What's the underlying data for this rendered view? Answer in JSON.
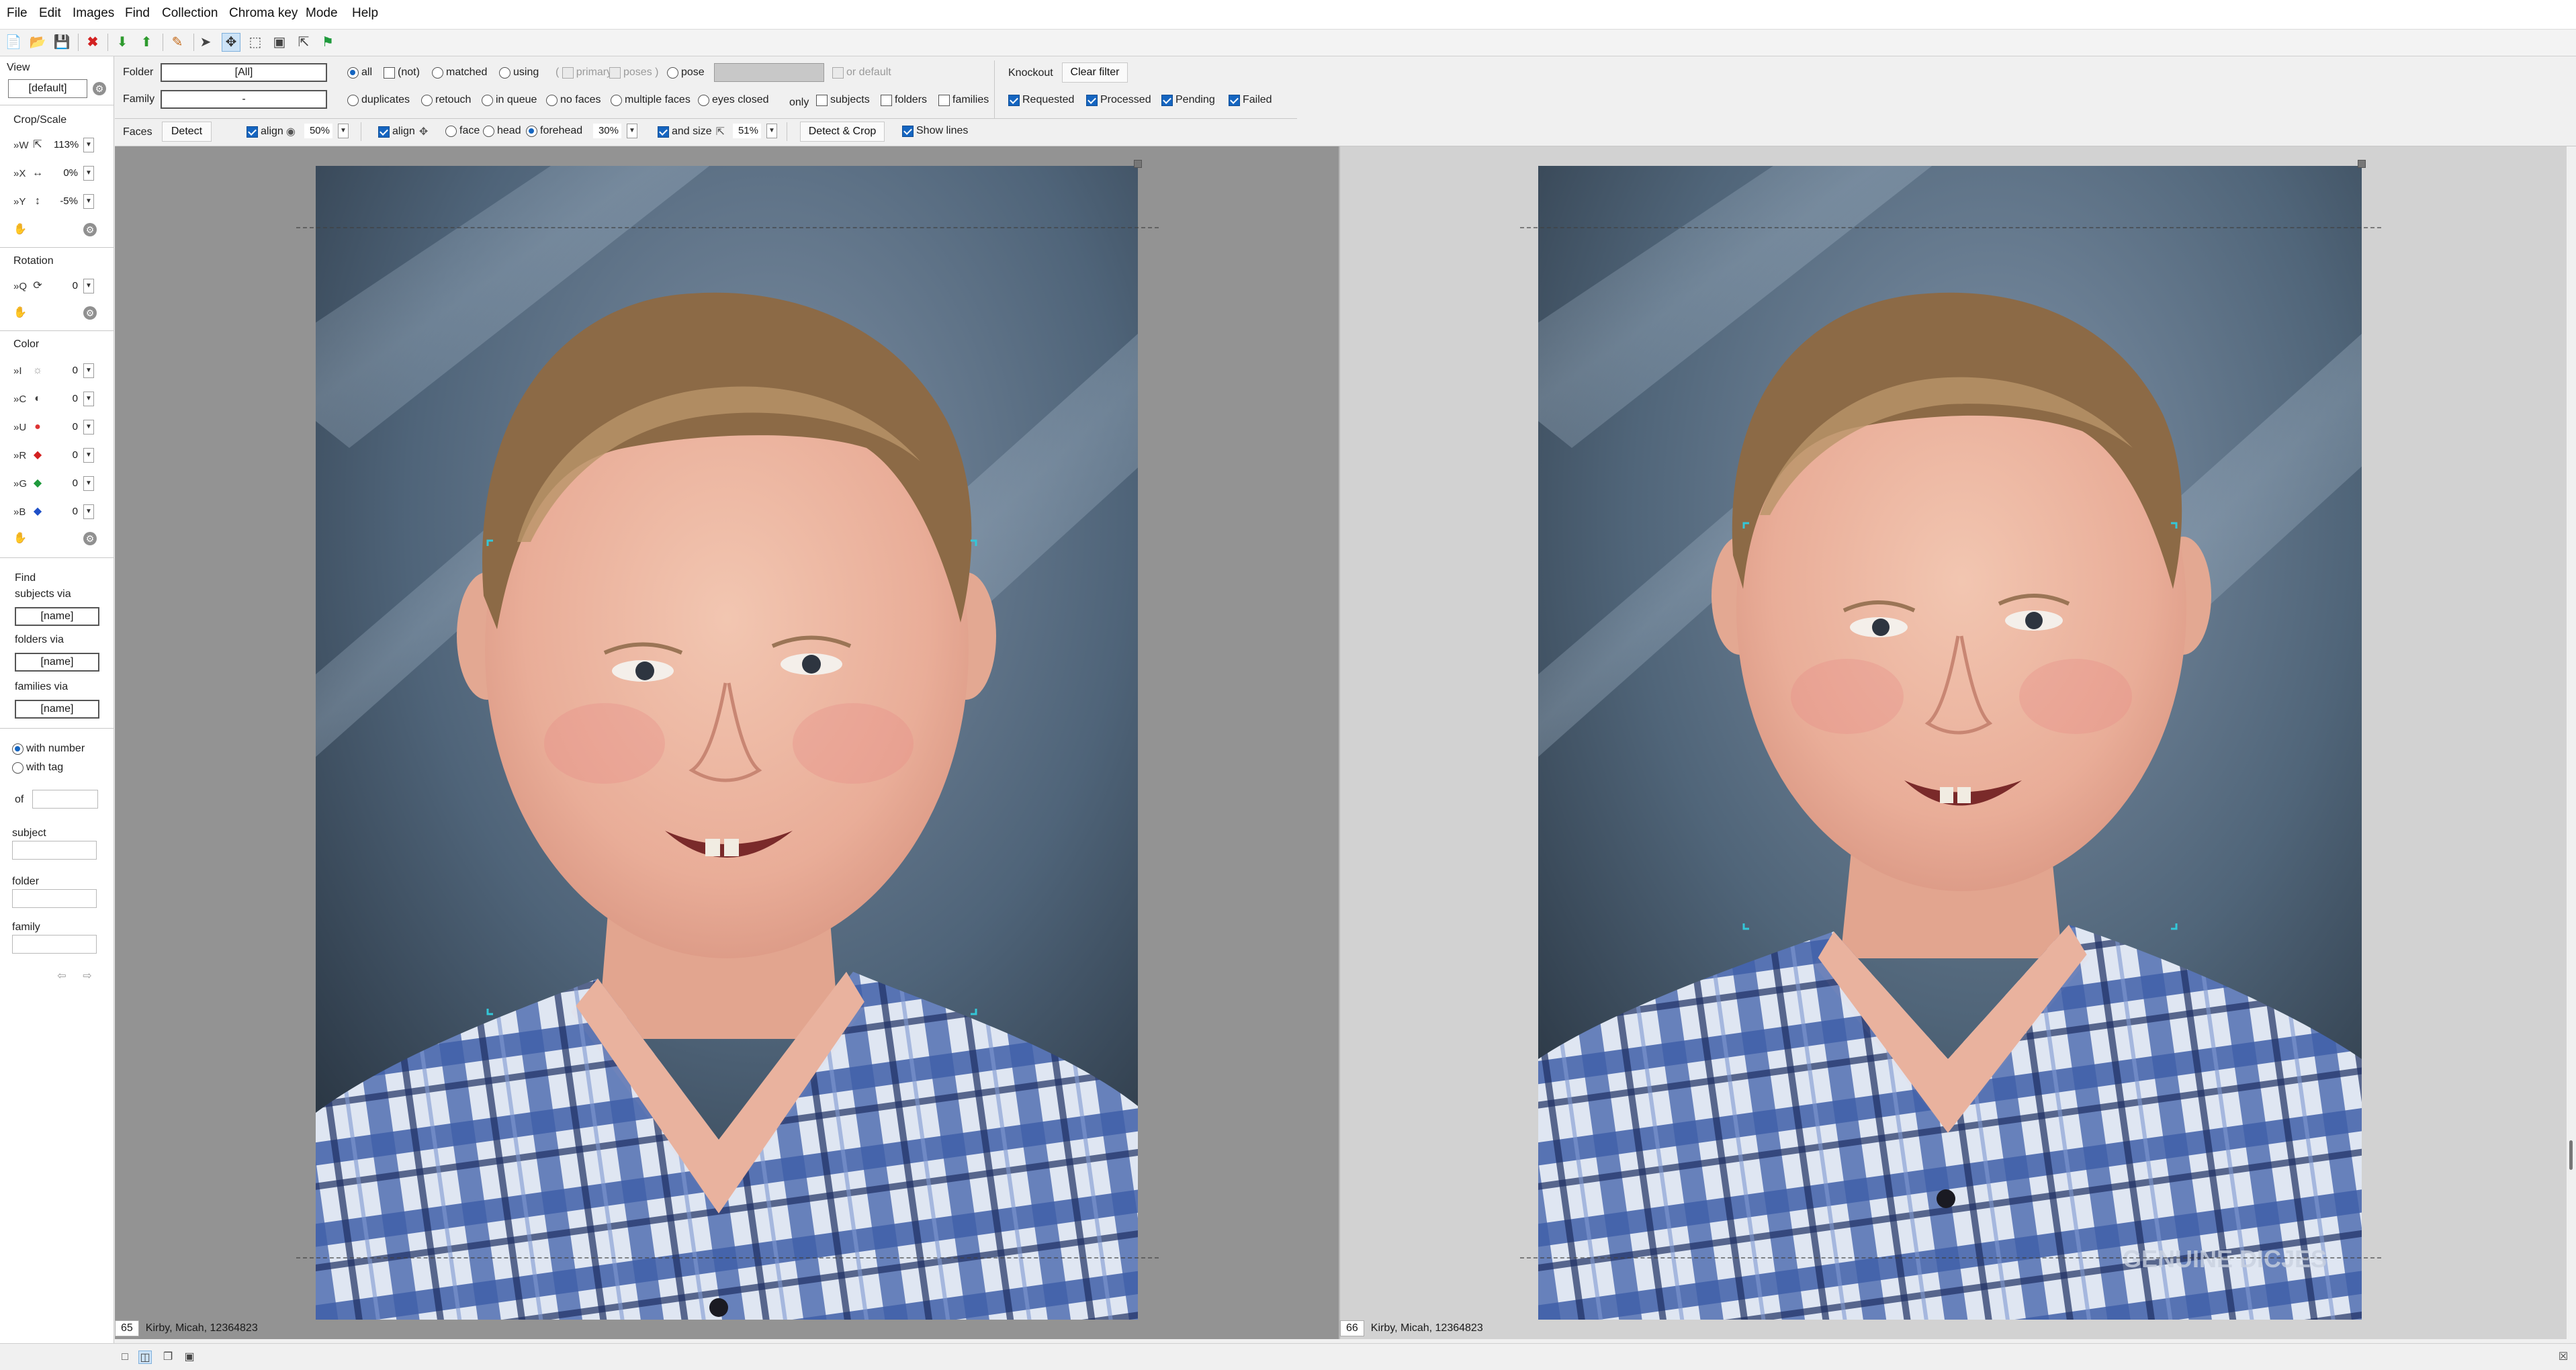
{
  "menu": [
    "File",
    "Edit",
    "Images",
    "Find",
    "Collection",
    "Chroma key",
    "Mode",
    "Help"
  ],
  "toolbar_icons": [
    "new-icon",
    "open-icon",
    "save-icon",
    "delete-icon",
    "import-icon",
    "export-icon",
    "brush-icon",
    "pointer-icon",
    "move-crop-icon",
    "select-crop-icon",
    "fit-icon",
    "align-icon",
    "flag-icon"
  ],
  "left": {
    "view_label": "View",
    "view_value": "[default]",
    "crop_scale_label": "Crop/Scale",
    "crop_rows": [
      {
        "prefix": "»W",
        "value": "113%"
      },
      {
        "prefix": "»X",
        "value": "0%"
      },
      {
        "prefix": "»Y",
        "value": "-5%"
      }
    ],
    "rotation_label": "Rotation",
    "rotation_row": {
      "prefix": "»Q",
      "value": "0"
    },
    "color_label": "Color",
    "color_rows": [
      {
        "prefix": "»I",
        "value": "0"
      },
      {
        "prefix": "»C",
        "value": "0"
      },
      {
        "prefix": "»U",
        "value": "0"
      },
      {
        "prefix": "»R",
        "value": "0"
      },
      {
        "prefix": "»G",
        "value": "0"
      },
      {
        "prefix": "»B",
        "value": "0"
      }
    ],
    "find_label": "Find",
    "subjects_via": "subjects via",
    "subjects_value": "[name]",
    "folders_via": "folders via",
    "folders_value": "[name]",
    "families_via": "families via",
    "families_value": "[name]",
    "with_number": "with number",
    "with_tag": "with tag",
    "of_label": "of",
    "subject_label": "subject",
    "folder_label": "folder",
    "family_label": "family"
  },
  "top": {
    "folder_label": "Folder",
    "folder_value": "[All]",
    "family_label": "Family",
    "family_value": "-",
    "row1": [
      "all",
      "(not)",
      "matched",
      "using",
      "primary",
      "poses",
      "pose"
    ],
    "or_default": "or default",
    "row2": [
      "duplicates",
      "retouch",
      "in queue",
      "no faces",
      "multiple faces",
      "eyes closed"
    ],
    "only_label": "only",
    "only_items": [
      "subjects",
      "folders",
      "families"
    ],
    "knockout_label": "Knockout",
    "clear_filter": "Clear filter",
    "knockout_items": [
      "Requested",
      "Processed",
      "Pending",
      "Failed"
    ],
    "faces_label": "Faces",
    "detect_btn": "Detect",
    "align1_label": "align",
    "align1_value": "50%",
    "align2_label": "align",
    "face_label": "face",
    "head_label": "head",
    "forehead_label": "forehead",
    "forehead_value": "30%",
    "andsize_label": "and size",
    "andsize_value": "51%",
    "detect_crop_btn": "Detect & Crop",
    "show_lines": "Show lines"
  },
  "viewers": [
    {
      "number": "65",
      "caption": "Kirby, Micah, 12364823"
    },
    {
      "number": "66",
      "caption": "Kirby, Micah, 12364823"
    }
  ],
  "colors": {
    "accent": "#1565c0",
    "left_bg": "#939393",
    "right_bg": "#d2d2d2"
  }
}
